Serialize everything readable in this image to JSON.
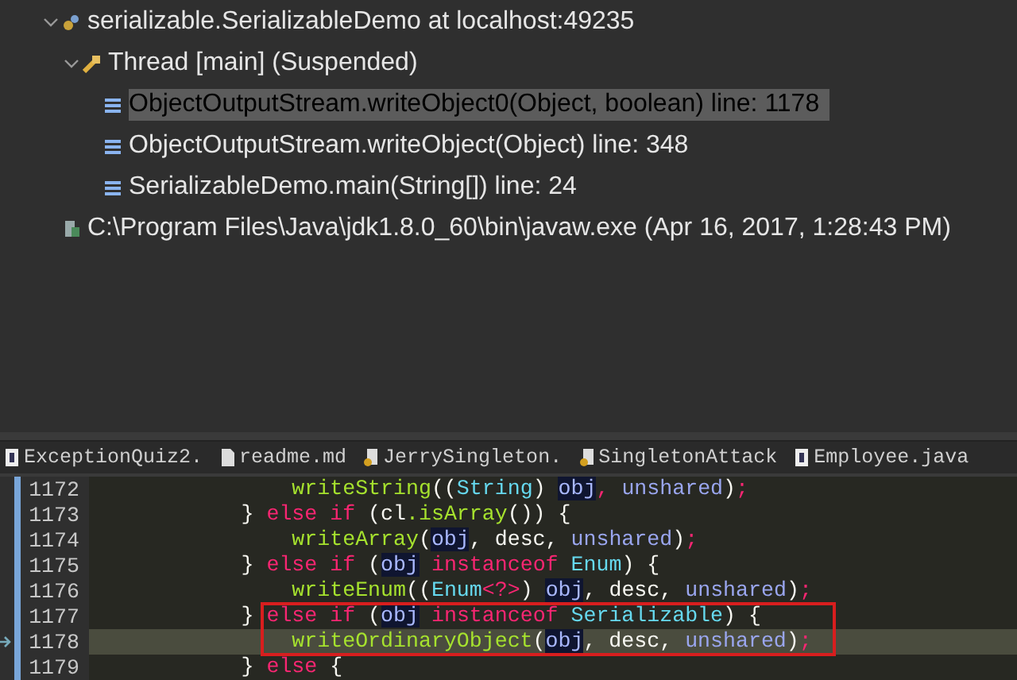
{
  "debug_tree": [
    {
      "label": "serializable.SerializableDemo at localhost:49235",
      "kind": "process",
      "expanded": true,
      "children": [
        {
          "label": "Thread [main] (Suspended)",
          "kind": "thread",
          "expanded": true,
          "children": [
            {
              "label": "ObjectOutputStream.writeObject0(Object, boolean) line: 1178",
              "kind": "frame",
              "selected": true
            },
            {
              "label": "ObjectOutputStream.writeObject(Object) line: 348",
              "kind": "frame",
              "selected": false
            },
            {
              "label": "SerializableDemo.main(String[]) line: 24",
              "kind": "frame",
              "selected": false
            }
          ]
        }
      ]
    },
    {
      "label": "C:\\Program Files\\Java\\jdk1.8.0_60\\bin\\javaw.exe (Apr 16, 2017, 1:28:43 PM)",
      "kind": "program"
    }
  ],
  "editor_tabs": [
    {
      "label": "ExceptionQuiz2.",
      "kind": "java"
    },
    {
      "label": "readme.md",
      "kind": "text"
    },
    {
      "label": "JerrySingleton.",
      "kind": "class"
    },
    {
      "label": "SingletonAttack",
      "kind": "class"
    },
    {
      "label": "Employee.java",
      "kind": "java"
    }
  ],
  "code_lines": [
    {
      "number": "1172",
      "current": false,
      "boxed": false,
      "tokens": [
        {
          "t": "                writeString",
          "kind": "method"
        },
        {
          "t": "((",
          "kind": "plain"
        },
        {
          "t": "String",
          "kind": "type"
        },
        {
          "t": ") ",
          "kind": "plain"
        },
        {
          "t": "obj",
          "kind": "occurrence"
        },
        {
          "t": ", ",
          "kind": "keyword"
        },
        {
          "t": "unshared",
          "kind": "param"
        },
        {
          "t": ")",
          "kind": "plain"
        },
        {
          "t": ";",
          "kind": "keyword"
        }
      ]
    },
    {
      "number": "1173",
      "current": false,
      "boxed": false,
      "tokens": [
        {
          "t": "            } ",
          "kind": "plain"
        },
        {
          "t": "else if",
          "kind": "keyword"
        },
        {
          "t": " (cl",
          "kind": "plain"
        },
        {
          "t": ".isArray",
          "kind": "method"
        },
        {
          "t": "()) {",
          "kind": "plain"
        }
      ]
    },
    {
      "number": "1174",
      "current": false,
      "boxed": false,
      "tokens": [
        {
          "t": "                writeArray",
          "kind": "method"
        },
        {
          "t": "(",
          "kind": "plain"
        },
        {
          "t": "obj",
          "kind": "occurrence"
        },
        {
          "t": ", desc, ",
          "kind": "plain"
        },
        {
          "t": "unshared",
          "kind": "param"
        },
        {
          "t": ")",
          "kind": "plain"
        },
        {
          "t": ";",
          "kind": "keyword"
        }
      ]
    },
    {
      "number": "1175",
      "current": false,
      "boxed": false,
      "tokens": [
        {
          "t": "            } ",
          "kind": "plain"
        },
        {
          "t": "else if",
          "kind": "keyword"
        },
        {
          "t": " (",
          "kind": "plain"
        },
        {
          "t": "obj",
          "kind": "occurrence"
        },
        {
          "t": " instanceof ",
          "kind": "keyword"
        },
        {
          "t": "Enum",
          "kind": "type"
        },
        {
          "t": ") {",
          "kind": "plain"
        }
      ]
    },
    {
      "number": "1176",
      "current": false,
      "boxed": false,
      "tokens": [
        {
          "t": "                writeEnum",
          "kind": "method"
        },
        {
          "t": "((",
          "kind": "plain"
        },
        {
          "t": "Enum",
          "kind": "type"
        },
        {
          "t": "<?>",
          "kind": "keyword"
        },
        {
          "t": ") ",
          "kind": "plain"
        },
        {
          "t": "obj",
          "kind": "occurrence"
        },
        {
          "t": ", desc, ",
          "kind": "plain"
        },
        {
          "t": "unshared",
          "kind": "param"
        },
        {
          "t": ")",
          "kind": "plain"
        },
        {
          "t": ";",
          "kind": "keyword"
        }
      ]
    },
    {
      "number": "1177",
      "current": false,
      "boxed": true,
      "tokens": [
        {
          "t": "            } ",
          "kind": "plain"
        },
        {
          "t": "else if",
          "kind": "keyword"
        },
        {
          "t": " (",
          "kind": "plain"
        },
        {
          "t": "obj",
          "kind": "occurrence"
        },
        {
          "t": " instanceof ",
          "kind": "keyword"
        },
        {
          "t": "Serializable",
          "kind": "type"
        },
        {
          "t": ") {",
          "kind": "plain"
        }
      ]
    },
    {
      "number": "1178",
      "current": true,
      "boxed": true,
      "tokens": [
        {
          "t": "                writeOrdinaryObject",
          "kind": "method"
        },
        {
          "t": "(",
          "kind": "plain"
        },
        {
          "t": "obj",
          "kind": "occurrence"
        },
        {
          "t": ", desc, ",
          "kind": "plain"
        },
        {
          "t": "unshared",
          "kind": "param"
        },
        {
          "t": ")",
          "kind": "plain"
        },
        {
          "t": ";",
          "kind": "keyword"
        }
      ]
    },
    {
      "number": "1179",
      "current": false,
      "boxed": false,
      "tokens": [
        {
          "t": "            } ",
          "kind": "plain"
        },
        {
          "t": "else",
          "kind": "keyword"
        },
        {
          "t": " {",
          "kind": "plain"
        }
      ]
    }
  ]
}
